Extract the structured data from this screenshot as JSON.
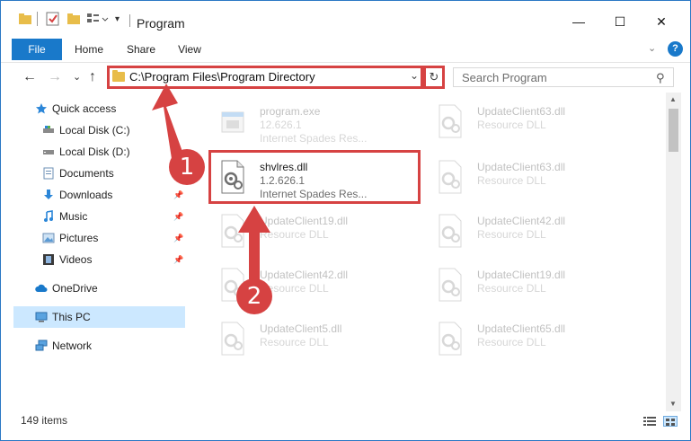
{
  "window": {
    "title": "Program",
    "controls": {
      "minimize": "—",
      "maximize": "☐",
      "close": "✕"
    }
  },
  "ribbon": {
    "tabs": [
      {
        "label": "File"
      },
      {
        "label": "Home"
      },
      {
        "label": "Share"
      },
      {
        "label": "View"
      }
    ],
    "help": "?"
  },
  "address": {
    "path": "C:\\Program Files\\Program Directory",
    "dropdown": "⌄",
    "refresh": "↻"
  },
  "navigation": {
    "back": "←",
    "forward": "→",
    "recent": "⌄",
    "up": "↑"
  },
  "search": {
    "placeholder": "Search Program"
  },
  "nav_pane": {
    "items": [
      {
        "label": "Quick access",
        "icon": "star-icon"
      },
      {
        "label": "Local Disk (C:)",
        "icon": "drive-icon"
      },
      {
        "label": "Local Disk (D:)",
        "icon": "drive-icon"
      },
      {
        "label": "Documents",
        "icon": "documents-icon"
      },
      {
        "label": "Downloads",
        "icon": "downloads-icon",
        "pinned": true
      },
      {
        "label": "Music",
        "icon": "music-icon",
        "pinned": true
      },
      {
        "label": "Pictures",
        "icon": "pictures-icon",
        "pinned": true
      },
      {
        "label": "Videos",
        "icon": "videos-icon",
        "pinned": true
      },
      {
        "label": "OneDrive",
        "icon": "cloud-icon"
      },
      {
        "label": "This PC",
        "icon": "computer-icon",
        "selected": true
      },
      {
        "label": "Network",
        "icon": "network-icon"
      }
    ]
  },
  "files": [
    {
      "name": "program.exe",
      "line2": "12.626.1",
      "line3": "Internet Spades Res...",
      "faded": true,
      "kind": "exe"
    },
    {
      "name": "UpdateClient63.dll",
      "line2": "Resource DLL",
      "line3": "",
      "faded": true,
      "kind": "dll"
    },
    {
      "name": "shvlres.dll",
      "line2": "1.2.626.1",
      "line3": "Internet Spades Res...",
      "faded": false,
      "kind": "dll"
    },
    {
      "name": "UpdateClient63.dll",
      "line2": "Resource DLL",
      "line3": "",
      "faded": true,
      "kind": "dll"
    },
    {
      "name": "UpdateClient19.dll",
      "line2": "Resource DLL",
      "line3": "",
      "faded": true,
      "kind": "dll"
    },
    {
      "name": "UpdateClient42.dll",
      "line2": "Resource DLL",
      "line3": "",
      "faded": true,
      "kind": "dll"
    },
    {
      "name": "UpdateClient42.dll",
      "line2": "Resource DLL",
      "line3": "",
      "faded": true,
      "kind": "dll"
    },
    {
      "name": "UpdateClient19.dll",
      "line2": "Resource DLL",
      "line3": "",
      "faded": true,
      "kind": "dll"
    },
    {
      "name": "UpdateClient5.dll",
      "line2": "Resource DLL",
      "line3": "",
      "faded": true,
      "kind": "dll"
    },
    {
      "name": "UpdateClient65.dll",
      "line2": "Resource DLL",
      "line3": "",
      "faded": true,
      "kind": "dll"
    }
  ],
  "status": {
    "item_count": "149 items"
  },
  "annotations": {
    "step1": "1",
    "step2": "2"
  },
  "colors": {
    "accent": "#1979ca",
    "highlight": "#d64242",
    "selection": "#cce8ff",
    "folder": "#e8bd4a"
  }
}
